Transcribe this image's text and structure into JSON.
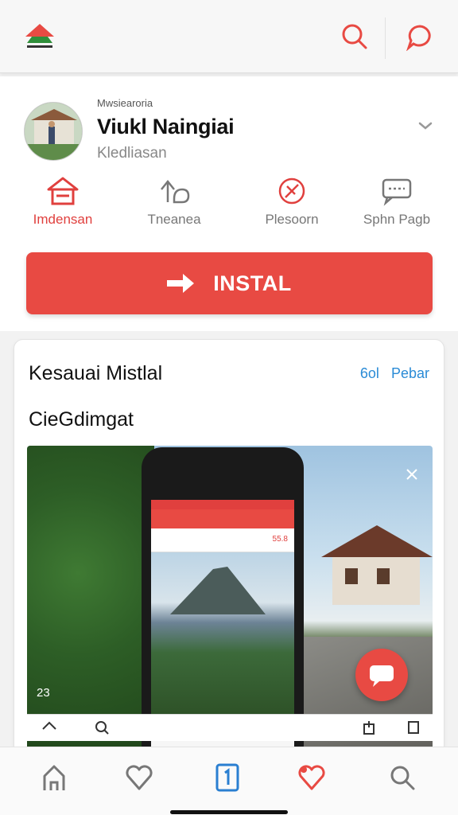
{
  "header": {
    "logo_icon": "house-logo-icon",
    "search_icon": "search-icon",
    "chat_icon": "chat-bubble-icon"
  },
  "app": {
    "meta_top": "Mwsiearoria",
    "name": "Viukl Naingiai",
    "subtitle": "Kledliasan"
  },
  "quick_actions": [
    {
      "label": "Imdensan",
      "icon": "home-icon",
      "active": true
    },
    {
      "label": "Tneanea",
      "icon": "share-icon",
      "active": false
    },
    {
      "label": "Plesoorn",
      "icon": "compass-icon",
      "active": false
    },
    {
      "label": "Sphn Pagb",
      "icon": "message-icon",
      "active": false
    }
  ],
  "install_button": {
    "label": "INSTAL",
    "icon": "arrow-right-icon"
  },
  "panel": {
    "title": "Kesauai Mistlal",
    "links": [
      "6ol",
      "Pebar"
    ],
    "subtitle": "CieGdimgat"
  },
  "screenshot": {
    "counter": "23",
    "phone_price": "55.8"
  },
  "bottom_nav": [
    {
      "icon": "home-icon"
    },
    {
      "icon": "heart-icon"
    },
    {
      "icon": "book-icon",
      "active": true
    },
    {
      "icon": "favorite-icon"
    },
    {
      "icon": "search-icon"
    }
  ],
  "colors": {
    "accent": "#e84a43",
    "link": "#2a8bd6"
  }
}
